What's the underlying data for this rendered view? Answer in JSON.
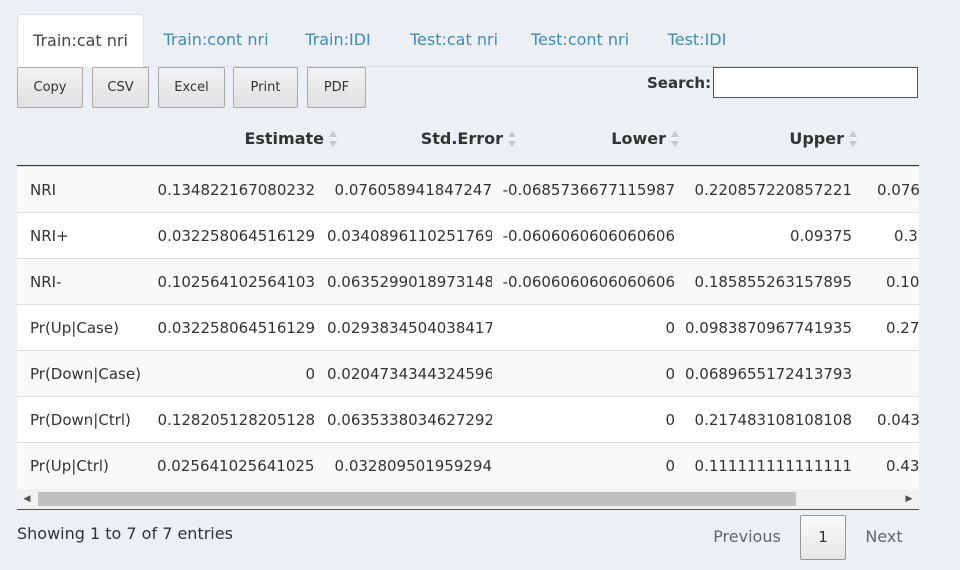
{
  "tabs": [
    "Train:cat nri",
    "Train:cont nri",
    "Train:IDI",
    "Test:cat nri",
    "Test:cont nri",
    "Test:IDI"
  ],
  "active_tab": "Train:cat nri",
  "toolbar": {
    "copy": "Copy",
    "csv": "CSV",
    "excel": "Excel",
    "print": "Print",
    "pdf": "PDF"
  },
  "search": {
    "label": "Search:",
    "value": ""
  },
  "table": {
    "headers": [
      "Estimate",
      "Std.Error",
      "Lower",
      "Upper"
    ],
    "rows": [
      {
        "label": "NRI",
        "cells": [
          "0.134822167080232",
          "0.076058941847247",
          "-0.0685736677115987",
          "0.220857220857221",
          "0.076"
        ]
      },
      {
        "label": "NRI+",
        "cells": [
          "0.032258064516129",
          "0.0340896110251769",
          "-0.0606060606060606",
          "0.09375",
          "0.3"
        ]
      },
      {
        "label": "NRI-",
        "cells": [
          "0.102564102564103",
          "0.0635299018973148",
          "-0.0606060606060606",
          "0.185855263157895",
          "0.10"
        ]
      },
      {
        "label": "Pr(Up|Case)",
        "cells": [
          "0.032258064516129",
          "0.0293834504038417",
          "0",
          "0.0983870967741935",
          "0.27"
        ]
      },
      {
        "label": "Pr(Down|Case)",
        "cells": [
          "0",
          "0.0204734344324596",
          "0",
          "0.0689655172413793",
          ""
        ]
      },
      {
        "label": "Pr(Down|Ctrl)",
        "cells": [
          "0.128205128205128",
          "0.0635338034627292",
          "0",
          "0.217483108108108",
          "0.043"
        ]
      },
      {
        "label": "Pr(Up|Ctrl)",
        "cells": [
          "0.0256410256410256",
          "0.032809501959294",
          "0",
          "0.111111111111111",
          "0.43"
        ]
      }
    ]
  },
  "footer": {
    "info": "Showing 1 to 7 of 7 entries",
    "previous": "Previous",
    "page": "1",
    "next": "Next"
  }
}
